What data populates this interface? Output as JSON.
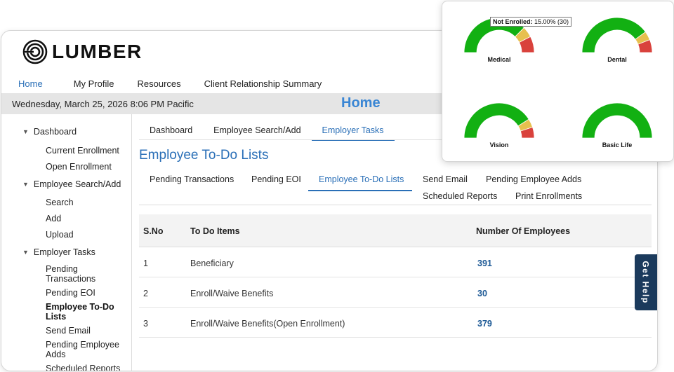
{
  "brand": {
    "name": "LUMBER"
  },
  "topnav": [
    "Home",
    "My Profile",
    "Resources",
    "Client Relationship Summary"
  ],
  "datebar": {
    "date": "Wednesday, March 25, 2026 8:06 PM Pacific",
    "title": "Home"
  },
  "sidebar": {
    "sections": [
      {
        "label": "Dashboard",
        "items": [
          "Current Enrollment",
          "Open Enrollment"
        ]
      },
      {
        "label": "Employee Search/Add",
        "items": [
          "Search",
          "Add",
          "Upload"
        ]
      },
      {
        "label": "Employer Tasks",
        "items": [
          "Pending Transactions",
          "Pending EOI",
          "Employee To-Do Lists",
          "Send Email",
          "Pending Employee Adds",
          "Scheduled Reports"
        ]
      }
    ]
  },
  "tabs_primary": [
    "Dashboard",
    "Employee Search/Add",
    "Employer Tasks"
  ],
  "page_heading": "Employee To-Do Lists",
  "tabs_secondary": [
    "Pending Transactions",
    "Pending EOI",
    "Employee To-Do Lists",
    "Send Email",
    "Pending Employee Adds",
    "Scheduled Reports",
    "Print Enrollments"
  ],
  "table": {
    "headers": [
      "S.No",
      "To Do Items",
      "Number Of Employees"
    ],
    "rows": [
      {
        "sno": "1",
        "item": "Beneficiary",
        "count": "391"
      },
      {
        "sno": "2",
        "item": "Enroll/Waive Benefits",
        "count": "30"
      },
      {
        "sno": "3",
        "item": "Enroll/Waive Benefits(Open Enrollment)",
        "count": "379"
      }
    ]
  },
  "get_help": "Get Help",
  "gauges": {
    "tooltip_label": "Not Enrolled:",
    "tooltip_value": "15.00% (30)",
    "colors": {
      "green": "#12b012",
      "yellow": "#e7c04e",
      "red": "#d9423c"
    },
    "items": [
      {
        "label": "Medical",
        "green": 0.75,
        "yellow": 0.1,
        "red": 0.15
      },
      {
        "label": "Dental",
        "green": 0.8,
        "yellow": 0.08,
        "red": 0.12
      },
      {
        "label": "Vision",
        "green": 0.82,
        "yellow": 0.08,
        "red": 0.1
      },
      {
        "label": "Basic Life",
        "green": 1.0,
        "yellow": 0,
        "red": 0
      }
    ]
  }
}
